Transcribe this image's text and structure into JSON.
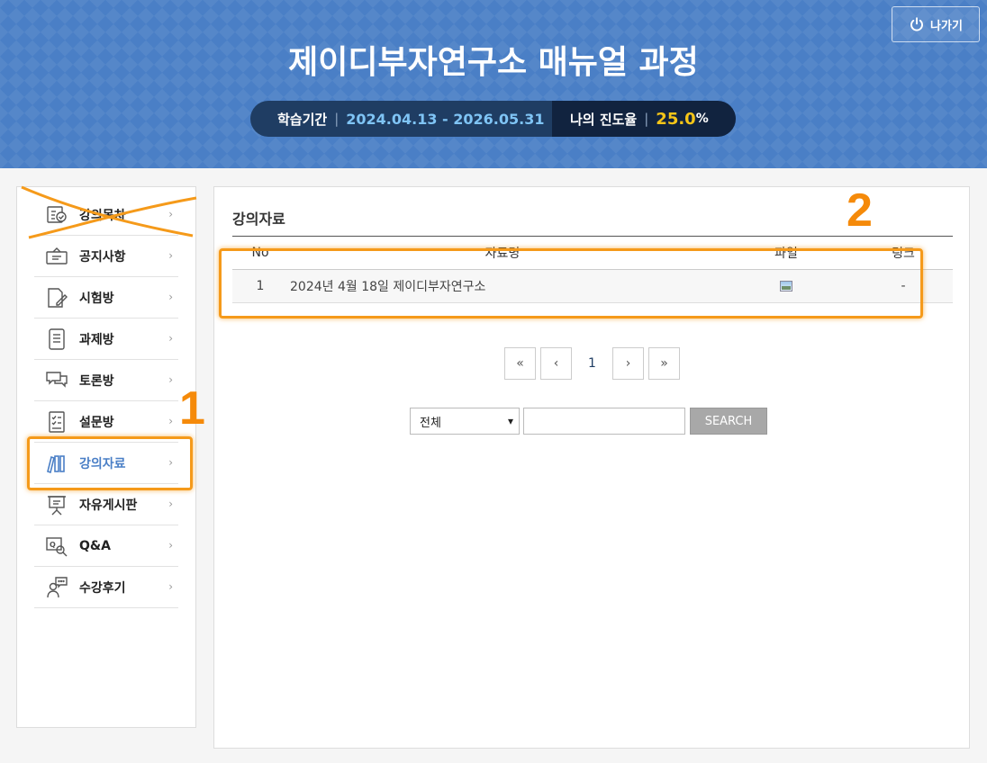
{
  "header": {
    "exit_label": "나가기",
    "course_title": "제이디부자연구소 매뉴얼 과정",
    "period_label": "학습기간",
    "period_dates": "2024.04.13 - 2026.05.31",
    "progress_label": "나의 진도율",
    "progress_value": "25.0",
    "progress_unit": "%"
  },
  "sidebar": {
    "items": [
      {
        "label": "강의목차",
        "icon": "list-check-icon"
      },
      {
        "label": "공지사항",
        "icon": "notice-board-icon"
      },
      {
        "label": "시험방",
        "icon": "exam-pencil-icon"
      },
      {
        "label": "과제방",
        "icon": "assignment-notebook-icon"
      },
      {
        "label": "토론방",
        "icon": "discussion-bubbles-icon"
      },
      {
        "label": "설문방",
        "icon": "survey-checklist-icon"
      },
      {
        "label": "강의자료",
        "icon": "books-icon"
      },
      {
        "label": "자유게시판",
        "icon": "easel-board-icon"
      },
      {
        "label": "Q&A",
        "icon": "qa-search-icon"
      },
      {
        "label": "수강후기",
        "icon": "review-person-icon"
      }
    ],
    "chevron": "›"
  },
  "main": {
    "title": "강의자료",
    "columns": {
      "no": "No",
      "name": "자료명",
      "file": "파일",
      "link": "링크"
    },
    "rows": [
      {
        "no": "1",
        "name": "2024년 4월 18일 제이디부자연구소",
        "link": "-"
      }
    ],
    "pager": {
      "first": "«",
      "prev": "‹",
      "current": "1",
      "next": "›",
      "last": "»"
    },
    "search": {
      "select_value": "전체",
      "input_value": "",
      "button_label": "SEARCH"
    }
  },
  "annotations": {
    "one": "1",
    "two": "2"
  },
  "colors": {
    "header_blue": "#4a7fc6",
    "accent_orange": "#f59a1a",
    "progress_yellow": "#f5c518"
  }
}
